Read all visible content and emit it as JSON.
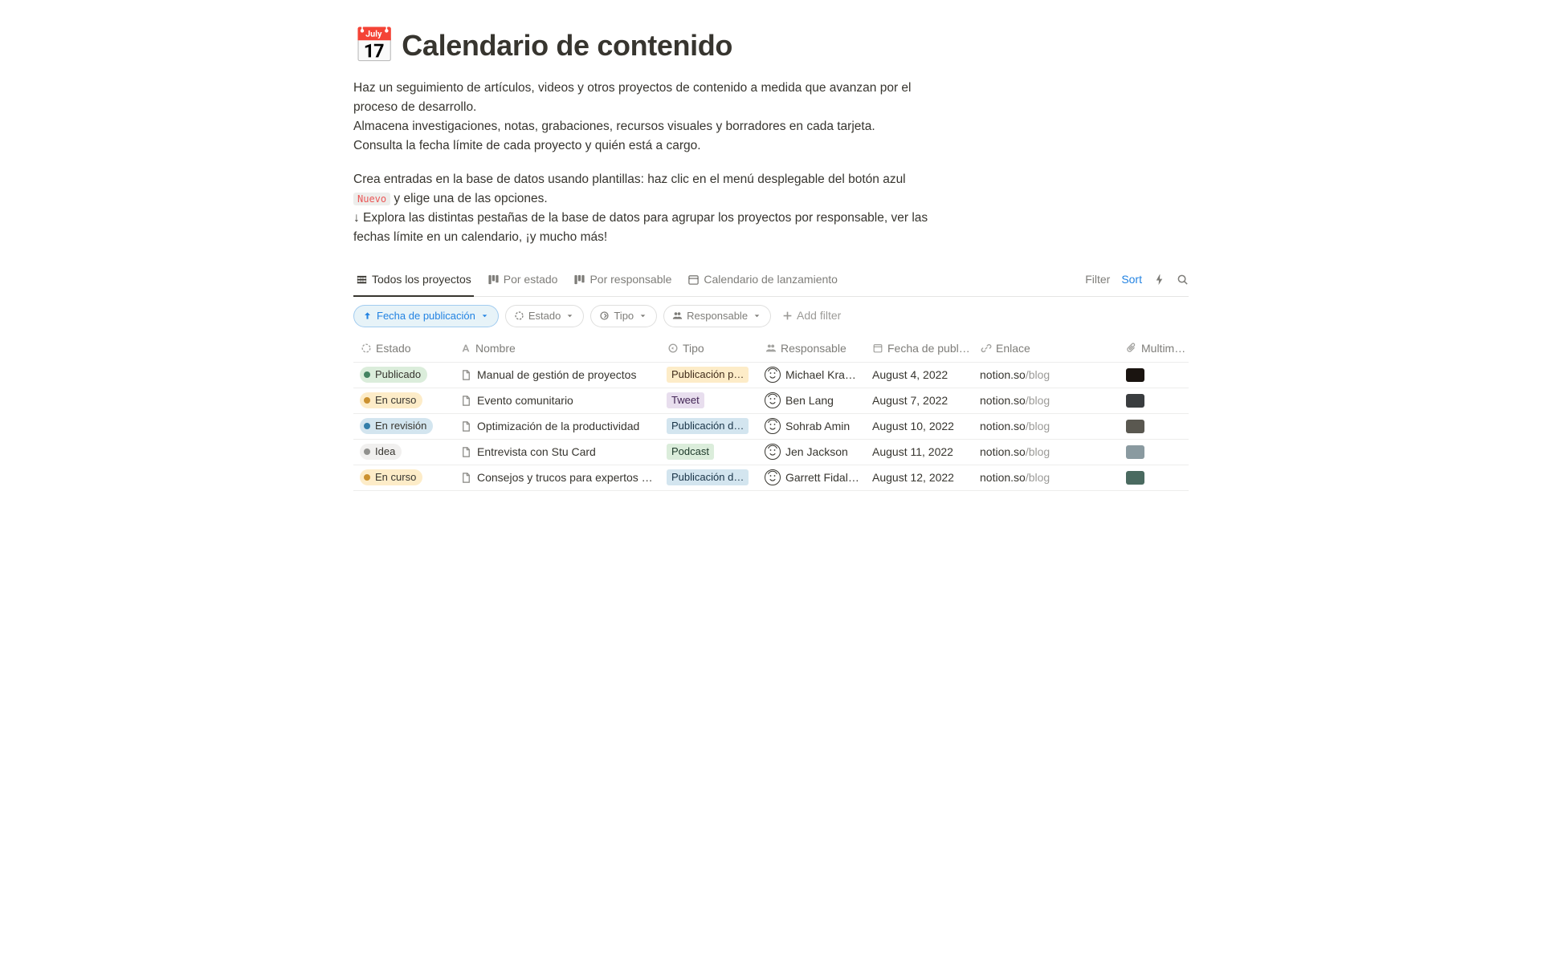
{
  "pageIcon": "📅",
  "pageTitle": "Calendario de contenido",
  "description": {
    "p1": "Haz un seguimiento de artículos, videos y otros proyectos de contenido a medida que avanzan por el proceso de desarrollo.",
    "p2": "Almacena investigaciones, notas, grabaciones, recursos visuales y borradores en cada tarjeta.",
    "p3": "Consulta la fecha límite de cada proyecto y quién está a cargo.",
    "p4a": "Crea entradas en la base de datos usando plantillas: haz clic en el menú desplegable del botón azul ",
    "p4code": "Nuevo",
    "p4b": " y elige una de las opciones.",
    "p5": "↓ Explora las distintas pestañas de la base de datos para agrupar los proyectos por responsable, ver las fechas límite en un calendario, ¡y mucho más!"
  },
  "views": {
    "tab1": "Todos los proyectos",
    "tab2": "Por estado",
    "tab3": "Por responsable",
    "tab4": "Calendario de lanzamiento"
  },
  "toolbar": {
    "filterLabel": "Filter",
    "sortLabel": "Sort"
  },
  "filters": {
    "sortChip": "Fecha de publicación",
    "f1": "Estado",
    "f2": "Tipo",
    "f3": "Responsable",
    "addFilter": "Add filter"
  },
  "columns": {
    "estado": "Estado",
    "nombre": "Nombre",
    "tipo": "Tipo",
    "responsable": "Responsable",
    "fecha": "Fecha de publ…",
    "enlace": "Enlace",
    "multimedia": "Multim…"
  },
  "statusLabels": {
    "publicado": "Publicado",
    "encurso": "En curso",
    "enrevision": "En revisión",
    "idea": "Idea"
  },
  "tipoLabels": {
    "pubp": "Publicación p…",
    "tweet": "Tweet",
    "pubd": "Publicación d…",
    "podcast": "Podcast"
  },
  "rows": [
    {
      "estadoKey": "publicado",
      "estadoBg": "bg-green",
      "estadoDot": "dot-green",
      "nombre": "Manual de gestión de proyectos",
      "tipoKey": "pubp",
      "tipoClass": "tag-yellow",
      "responsable": "Michael Krantz",
      "fecha": "August 4, 2022",
      "enlaceDomain": "notion.so",
      "enlacePath": "/blog",
      "thumbBg": "#1a1410"
    },
    {
      "estadoKey": "encurso",
      "estadoBg": "bg-yellow",
      "estadoDot": "dot-yellow",
      "nombre": "Evento comunitario",
      "tipoKey": "tweet",
      "tipoClass": "tag-purple",
      "responsable": "Ben Lang",
      "fecha": "August 7, 2022",
      "enlaceDomain": "notion.so",
      "enlacePath": "/blog",
      "thumbBg": "#3a3d3f"
    },
    {
      "estadoKey": "enrevision",
      "estadoBg": "bg-blue",
      "estadoDot": "dot-blue",
      "nombre": "Optimización de la productividad",
      "tipoKey": "pubd",
      "tipoClass": "tag-blue",
      "responsable": "Sohrab Amin",
      "fecha": "August 10, 2022",
      "enlaceDomain": "notion.so",
      "enlacePath": "/blog",
      "thumbBg": "#5a5850"
    },
    {
      "estadoKey": "idea",
      "estadoBg": "bg-gray",
      "estadoDot": "dot-gray",
      "nombre": "Entrevista con Stu Card",
      "tipoKey": "podcast",
      "tipoClass": "tag-green",
      "responsable": "Jen Jackson",
      "fecha": "August 11, 2022",
      "enlaceDomain": "notion.so",
      "enlacePath": "/blog",
      "thumbBg": "#8a9aa0"
    },
    {
      "estadoKey": "encurso",
      "estadoBg": "bg-yellow",
      "estadoDot": "dot-yellow",
      "nombre": "Consejos y trucos para expertos en A",
      "tipoKey": "pubd",
      "tipoClass": "tag-blue",
      "responsable": "Garrett Fidalgo",
      "fecha": "August 12, 2022",
      "enlaceDomain": "notion.so",
      "enlacePath": "/blog",
      "thumbBg": "#4a6a60"
    }
  ]
}
